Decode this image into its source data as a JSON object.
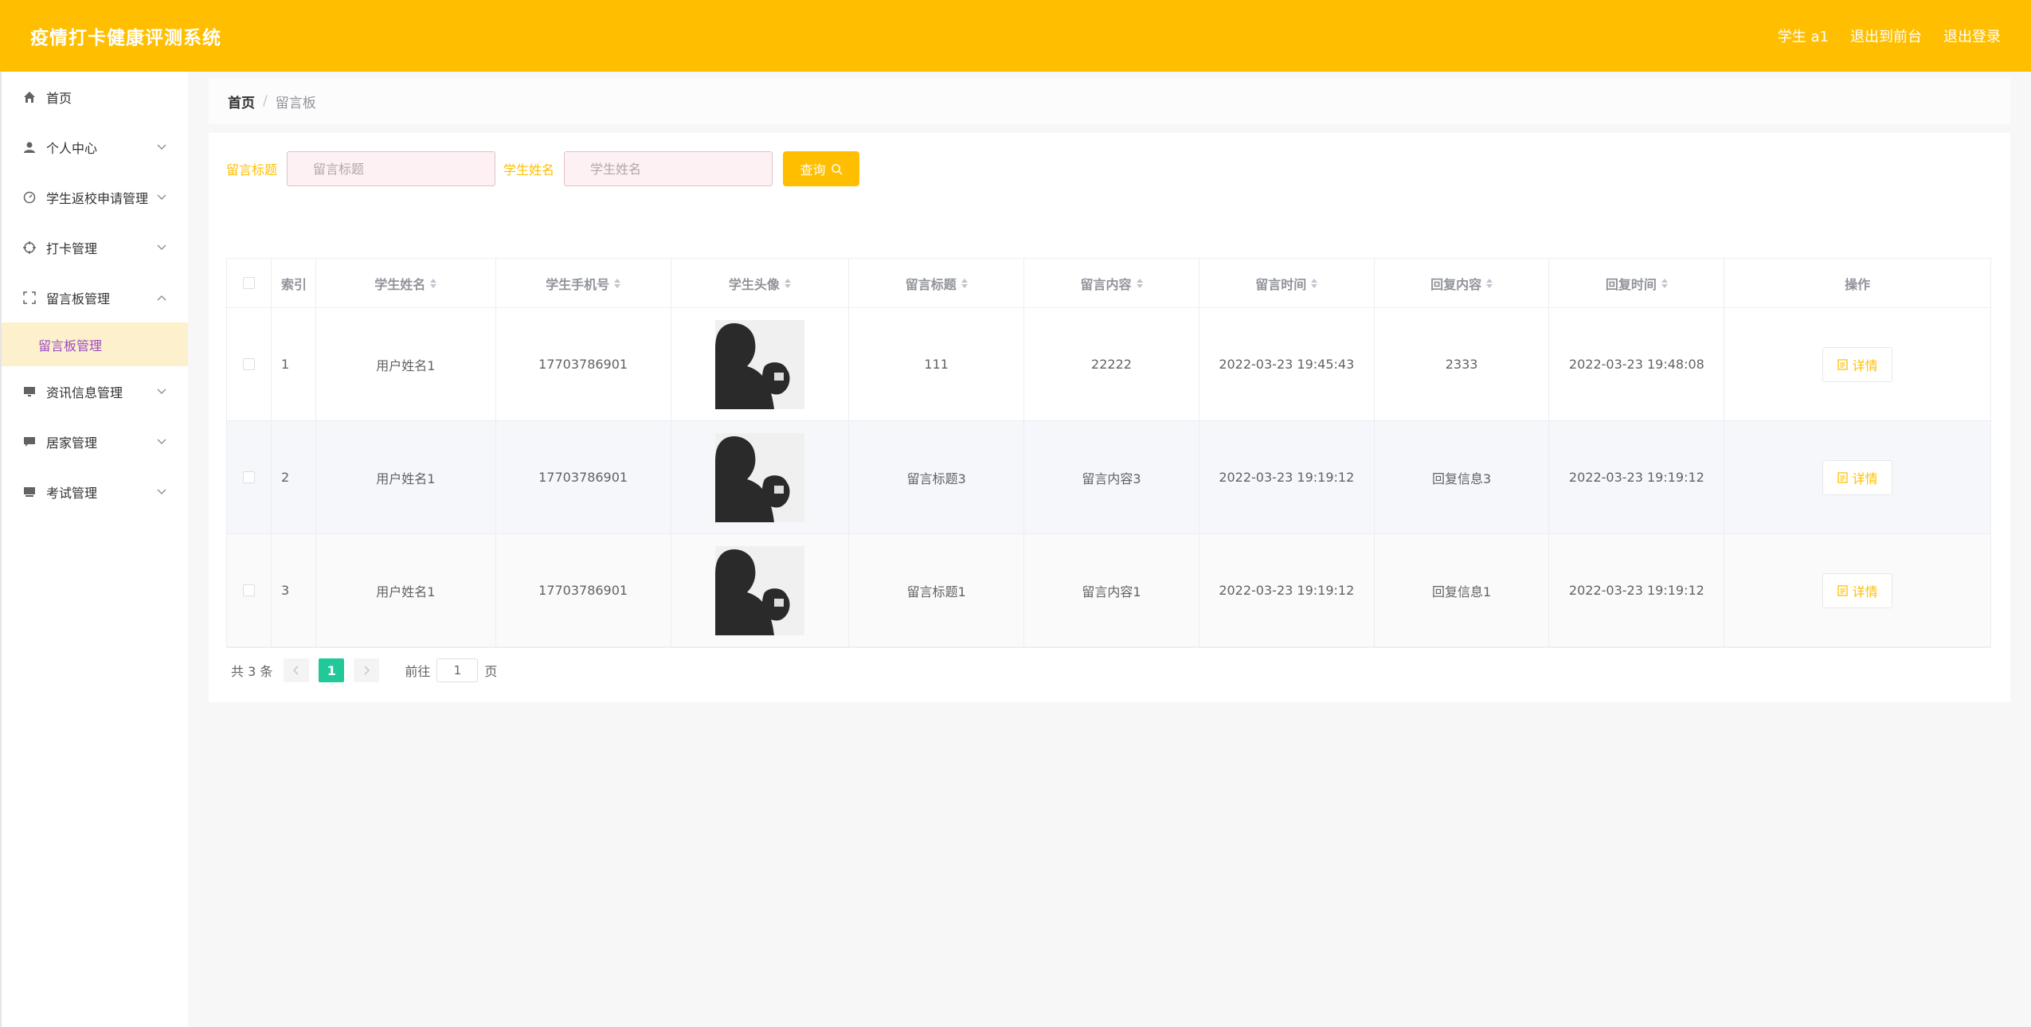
{
  "header": {
    "title": "疫情打卡健康评测系统",
    "user": "学生 a1",
    "to_front": "退出到前台",
    "logout": "退出登录"
  },
  "sidebar": {
    "items": [
      {
        "label": "首页",
        "icon": "home-icon"
      },
      {
        "label": "个人中心",
        "icon": "user-icon"
      },
      {
        "label": "学生返校申请管理",
        "icon": "gauge-icon"
      },
      {
        "label": "打卡管理",
        "icon": "crosshair-icon"
      },
      {
        "label": "留言板管理",
        "icon": "fullscreen-icon"
      },
      {
        "label": "资讯信息管理",
        "icon": "monitor-icon"
      },
      {
        "label": "居家管理",
        "icon": "chat-icon"
      },
      {
        "label": "考试管理",
        "icon": "printer-icon"
      }
    ],
    "subitem": "留言板管理"
  },
  "breadcrumb": {
    "home": "首页",
    "sep": "/",
    "current": "留言板"
  },
  "search": {
    "title_label": "留言标题",
    "title_placeholder": "留言标题",
    "name_label": "学生姓名",
    "name_placeholder": "学生姓名",
    "query_label": "查询"
  },
  "table": {
    "headers": [
      "索引",
      "学生姓名",
      "学生手机号",
      "学生头像",
      "留言标题",
      "留言内容",
      "留言时间",
      "回复内容",
      "回复时间",
      "操作"
    ],
    "rows": [
      {
        "idx": "1",
        "name": "用户姓名1",
        "phone": "17703786901",
        "title": "111",
        "content": "22222",
        "time": "2022-03-23 19:45:43",
        "reply": "2333",
        "rtime": "2022-03-23 19:48:08"
      },
      {
        "idx": "2",
        "name": "用户姓名1",
        "phone": "17703786901",
        "title": "留言标题3",
        "content": "留言内容3",
        "time": "2022-03-23 19:19:12",
        "reply": "回复信息3",
        "rtime": "2022-03-23 19:19:12"
      },
      {
        "idx": "3",
        "name": "用户姓名1",
        "phone": "17703786901",
        "title": "留言标题1",
        "content": "留言内容1",
        "time": "2022-03-23 19:19:12",
        "reply": "回复信息1",
        "rtime": "2022-03-23 19:19:12"
      }
    ],
    "detail_label": "详情"
  },
  "pagination": {
    "total": "共 3 条",
    "current": "1",
    "goto": "前往",
    "page_value": "1",
    "page_suffix": "页"
  },
  "colors": {
    "accent": "#ffbf00",
    "active_page": "#20c997",
    "submenu_bg": "#fdf0cc",
    "submenu_text": "#9b4bc4"
  }
}
